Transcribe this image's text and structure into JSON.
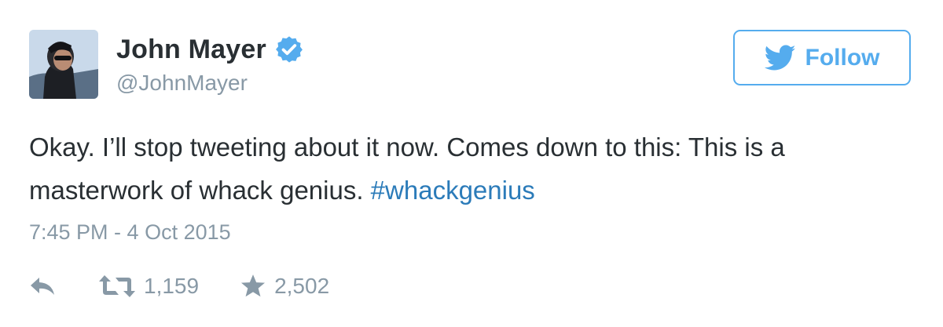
{
  "user": {
    "display_name": "John Mayer",
    "handle": "@JohnMayer",
    "verified": true
  },
  "follow_button": {
    "label": "Follow",
    "icon": "twitter-bird-icon"
  },
  "tweet": {
    "text": "Okay. I’ll stop tweeting about it now. Comes down to this: This is a masterwork of whack genius. ",
    "hashtag": "#whackgenius",
    "timestamp": "7:45 PM - 4 Oct 2015"
  },
  "actions": {
    "reply": {
      "icon": "reply-icon"
    },
    "retweet": {
      "icon": "retweet-icon",
      "count": "1,159"
    },
    "favorite": {
      "icon": "star-icon",
      "count": "2,502"
    }
  },
  "colors": {
    "accent": "#55acee",
    "link": "#2b7bb9",
    "muted": "#8899a6",
    "text": "#292f33"
  }
}
